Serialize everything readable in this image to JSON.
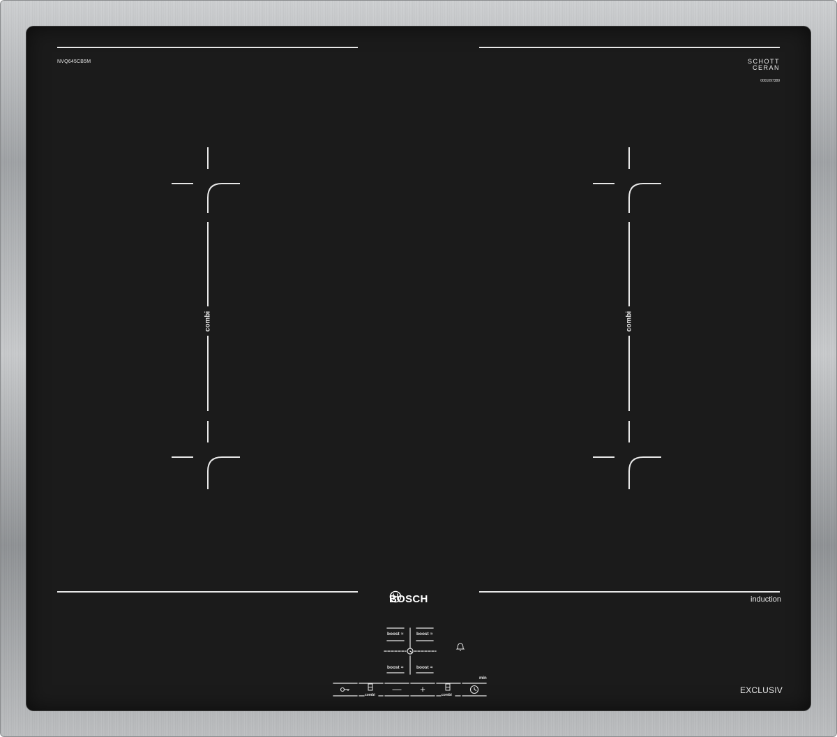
{
  "hob": {
    "model": "NVQ645CB5M",
    "glass_brand_line1": "SCHOTT",
    "glass_brand_line2": "CERAN",
    "glass_serial": "0001097389",
    "brand": "BOSCH",
    "technology": "induction",
    "series": "EXCLUSIV"
  },
  "zones": {
    "left_label": "combi",
    "right_label": "combi"
  },
  "controls": {
    "boost_label": "boost",
    "boost_symbol": "≈",
    "combi_label": "combi",
    "minus_symbol": "—",
    "plus_symbol": "+",
    "min_label": "min",
    "timer_bell_icon": "bell-icon",
    "timer_icon": "clock-icon",
    "power_icon": "key-icon"
  },
  "colors": {
    "glass": "#1b1b1b",
    "frame": "#b8babc",
    "print": "#e8e8e8"
  }
}
